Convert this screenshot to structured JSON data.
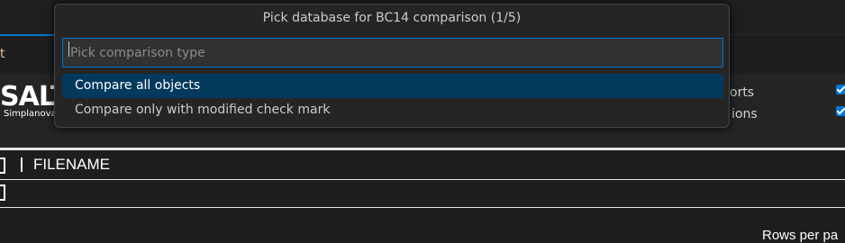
{
  "editor": {
    "tab_fragment": "t",
    "logo_text": "SALT",
    "logo_subtitle": "Simplanova",
    "options": [
      "orts",
      "ions"
    ],
    "column_header": "FILENAME",
    "rows_per_page_label": "Rows per pa"
  },
  "quick_pick": {
    "title": "Pick database for BC14 comparison (1/5)",
    "placeholder": "Pick comparison type",
    "items": [
      {
        "label": "Compare all objects",
        "active": true
      },
      {
        "label": "Compare only with modified check mark",
        "active": false
      }
    ]
  },
  "colors": {
    "accent": "#0078d4",
    "selected_item_bg": "#04395e",
    "panel_bg": "#252526"
  }
}
